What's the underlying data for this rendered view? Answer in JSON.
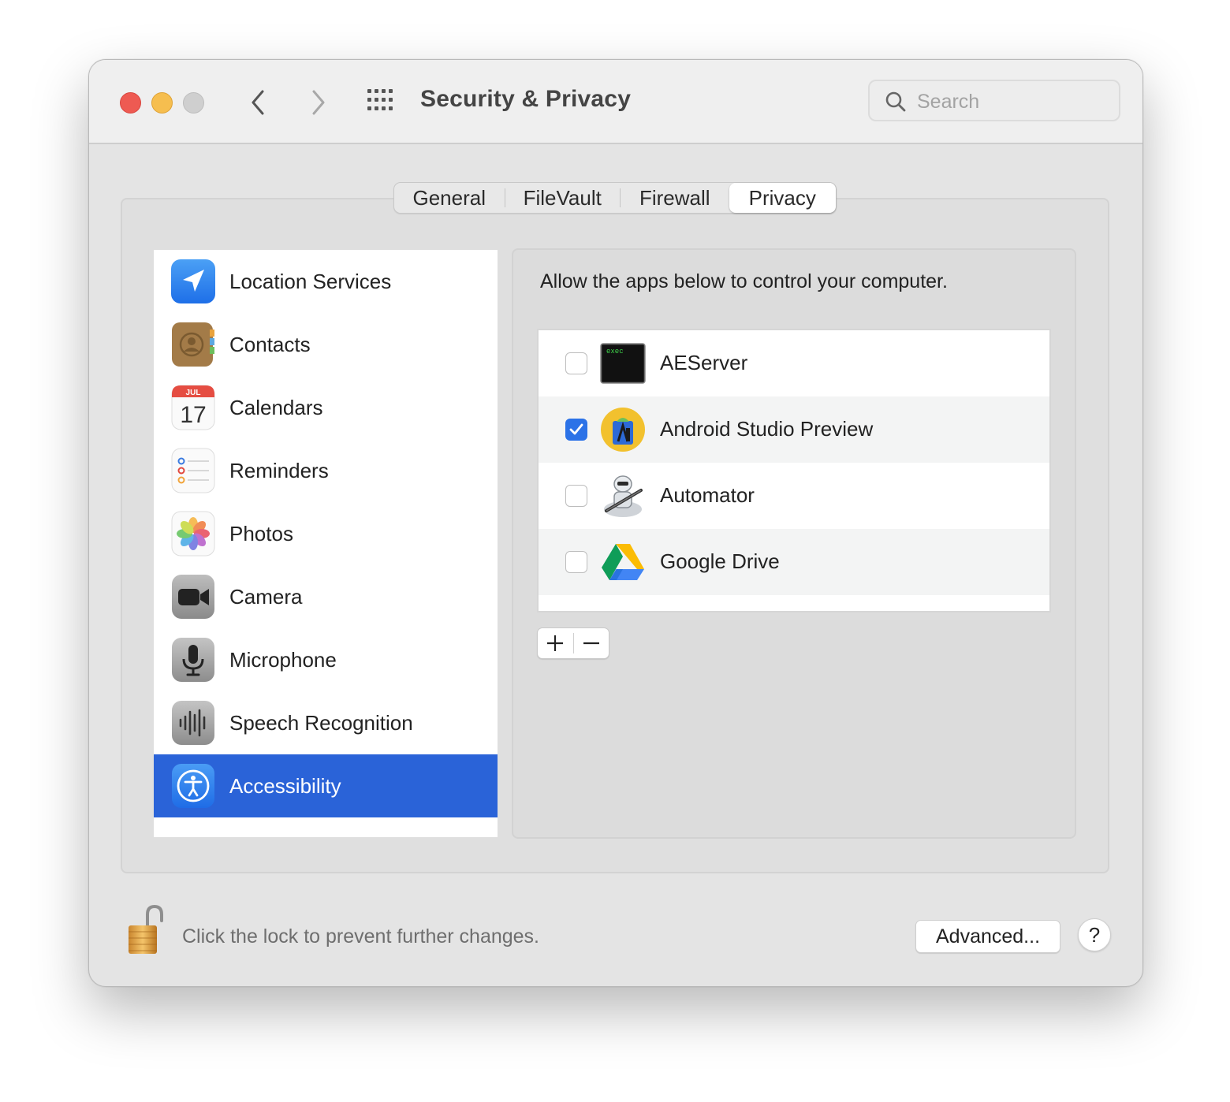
{
  "window": {
    "title": "Security & Privacy",
    "search_placeholder": "Search"
  },
  "tabs": [
    {
      "label": "General",
      "selected": false
    },
    {
      "label": "FileVault",
      "selected": false
    },
    {
      "label": "Firewall",
      "selected": false
    },
    {
      "label": "Privacy",
      "selected": true
    }
  ],
  "sidebar": {
    "items": [
      {
        "label": "Location Services",
        "icon": "location-arrow-icon"
      },
      {
        "label": "Contacts",
        "icon": "contacts-book-icon"
      },
      {
        "label": "Calendars",
        "icon": "calendar-icon",
        "icon_month": "JUL",
        "icon_day": "17"
      },
      {
        "label": "Reminders",
        "icon": "reminders-icon"
      },
      {
        "label": "Photos",
        "icon": "photos-flower-icon"
      },
      {
        "label": "Camera",
        "icon": "camera-icon"
      },
      {
        "label": "Microphone",
        "icon": "microphone-icon"
      },
      {
        "label": "Speech Recognition",
        "icon": "waveform-icon"
      },
      {
        "label": "Accessibility",
        "icon": "accessibility-icon",
        "selected": true
      }
    ]
  },
  "main": {
    "description": "Allow the apps below to control your computer.",
    "apps": [
      {
        "name": "AEServer",
        "checked": false,
        "icon": "terminal-exec-icon",
        "icon_text": "exec"
      },
      {
        "name": "Android Studio Preview",
        "checked": true,
        "icon": "android-studio-icon"
      },
      {
        "name": "Automator",
        "checked": false,
        "icon": "automator-robot-icon"
      },
      {
        "name": "Google Drive",
        "checked": false,
        "icon": "google-drive-icon"
      }
    ],
    "add_button": "+",
    "remove_button": "−"
  },
  "footer": {
    "lock_text": "Click the lock to prevent further changes.",
    "advanced_button": "Advanced...",
    "help_button": "?"
  },
  "colors": {
    "accent": "#2A63D8",
    "checkbox_on": "#2B72E7",
    "close": "#EE5A52",
    "minimize": "#F6BE4F",
    "zoom_disabled": "#CFCFCF"
  }
}
